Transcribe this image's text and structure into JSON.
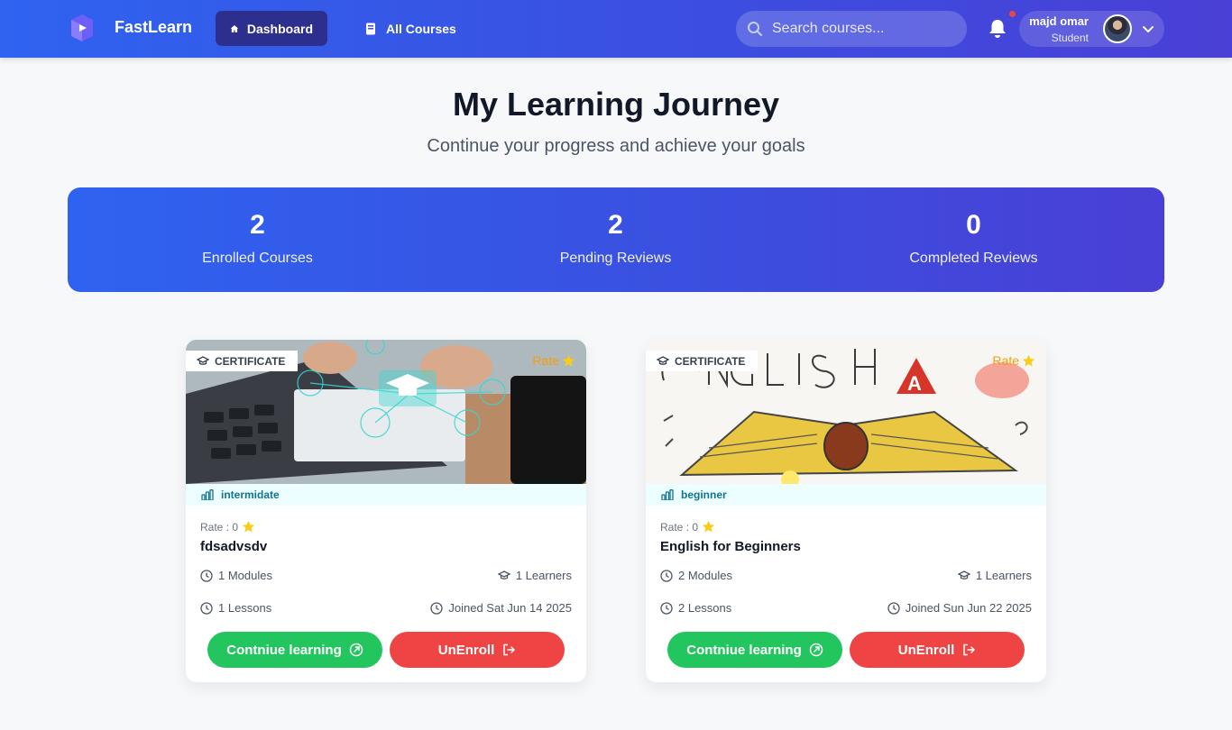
{
  "header": {
    "brand": "FastLearn",
    "nav": {
      "dashboard": "Dashboard",
      "all_courses": "All Courses"
    },
    "search_placeholder": "Search courses...",
    "user": {
      "name": "majd omar",
      "role": "Student"
    }
  },
  "hero": {
    "title": "My Learning Journey",
    "subtitle": "Continue your progress and achieve your goals"
  },
  "stats": [
    {
      "value": "2",
      "label": "Enrolled Courses"
    },
    {
      "value": "2",
      "label": "Pending Reviews"
    },
    {
      "value": "0",
      "label": "Completed Reviews"
    }
  ],
  "courses": [
    {
      "badge": "CERTIFICATE",
      "rate_corner": "Rate",
      "level": "intermidate",
      "rate_line": "Rate : 0",
      "title": "fdsadvsdv",
      "modules": "1 Modules",
      "learners": "1 Learners",
      "lessons": "1 Lessons",
      "joined": "Joined Sat Jun 14 2025",
      "continue_label": "Contniue learning",
      "unenroll_label": "UnEnroll"
    },
    {
      "badge": "CERTIFICATE",
      "rate_corner": "Rate",
      "level": "beginner",
      "rate_line": "Rate : 0",
      "title": "English for Beginners",
      "modules": "2 Modules",
      "learners": "1 Learners",
      "lessons": "2 Lessons",
      "joined": "Joined Sun Jun 22 2025",
      "continue_label": "Contniue learning",
      "unenroll_label": "UnEnroll"
    }
  ],
  "colors": {
    "header_start": "#2f63f0",
    "header_end": "#4a3fd6",
    "active_nav": "#2d2f8f",
    "continue_button": "#22c55e",
    "unenroll_button": "#ef4444",
    "rate_star": "#facc15",
    "level_text": "#0e7490"
  },
  "icons": [
    "logo-icon",
    "home-icon",
    "book-icon",
    "search-icon",
    "bell-icon",
    "chevron-down-icon",
    "graduation-cap-icon",
    "star-icon",
    "bar-chart-icon",
    "clock-icon",
    "external-link-icon",
    "logout-icon"
  ]
}
